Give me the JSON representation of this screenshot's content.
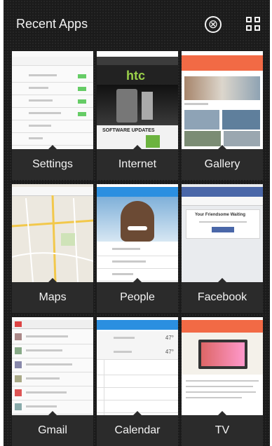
{
  "header": {
    "title": "Recent Apps",
    "close_icon": "⊗",
    "grid_icon": "grid-icon"
  },
  "apps": [
    {
      "name": "Settings"
    },
    {
      "name": "Internet"
    },
    {
      "name": "Gallery"
    },
    {
      "name": "Maps"
    },
    {
      "name": "People"
    },
    {
      "name": "Facebook"
    },
    {
      "name": "Gmail"
    },
    {
      "name": "Calendar"
    },
    {
      "name": "TV"
    }
  ],
  "thumbnail_text": {
    "internet_logo": "htc",
    "internet_headline": "SOFTWARE UPDATES",
    "facebook_heading": "Your Friendsome Waiting",
    "calendar_temp_1": "47°",
    "calendar_temp_2": "47°"
  },
  "colors": {
    "background": "#1b1b1b",
    "gallery_accent": "#f26a45",
    "people_accent": "#2b8fe0",
    "facebook_accent": "#4a67a8",
    "calendar_accent": "#2b8fe0",
    "tv_accent": "#f26a45",
    "maps_road": "#f2c84b"
  }
}
